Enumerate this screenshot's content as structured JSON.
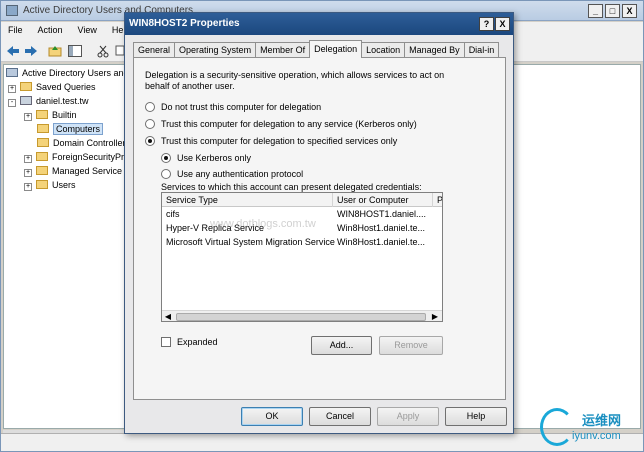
{
  "background_window": {
    "title": "Active Directory Users and Computers",
    "menu": [
      "File",
      "Action",
      "View",
      "Help"
    ],
    "tree": [
      {
        "label": "Active Directory Users and Computers",
        "type": "root"
      },
      {
        "label": "Saved Queries",
        "type": "folder",
        "expander": "+"
      },
      {
        "label": "daniel.test.tw",
        "type": "domain",
        "expander": "-"
      },
      {
        "label": "Builtin",
        "type": "folder",
        "expander": "+"
      },
      {
        "label": "Computers",
        "type": "folder",
        "selected": true
      },
      {
        "label": "Domain Controllers",
        "type": "folder"
      },
      {
        "label": "ForeignSecurityPrincipals",
        "type": "folder",
        "expander": "+"
      },
      {
        "label": "Managed Service Accounts",
        "type": "folder",
        "expander": "+"
      },
      {
        "label": "Users",
        "type": "folder",
        "expander": "+"
      }
    ],
    "window_buttons": [
      "_",
      "□",
      "X"
    ]
  },
  "dialog": {
    "title": "WIN8HOST2 Properties",
    "title_buttons": [
      "?",
      "X"
    ],
    "tabs": [
      {
        "label": "General",
        "active": false
      },
      {
        "label": "Operating System",
        "active": false
      },
      {
        "label": "Member Of",
        "active": false
      },
      {
        "label": "Delegation",
        "active": true
      },
      {
        "label": "Location",
        "active": false
      },
      {
        "label": "Managed By",
        "active": false
      },
      {
        "label": "Dial-in",
        "active": false
      }
    ],
    "description": "Delegation is a security-sensitive operation, which allows services to act on behalf of another user.",
    "options": {
      "opt1": "Do not trust this computer for delegation",
      "opt2": "Trust this computer for delegation to any service (Kerberos only)",
      "opt3": "Trust this computer for delegation to specified services only",
      "sub1": "Use Kerberos only",
      "sub2": "Use any authentication protocol",
      "selected": "opt3",
      "sub_selected": "sub1"
    },
    "services_label": "Services to which this account can present delegated credentials:",
    "services_table": {
      "columns": [
        "Service Type",
        "User or Computer",
        "P"
      ],
      "rows": [
        [
          "cifs",
          "WIN8HOST1.daniel...."
        ],
        [
          "Hyper-V Replica Service",
          "Win8Host1.daniel.te..."
        ],
        [
          "Microsoft Virtual System Migration Service",
          "Win8Host1.daniel.te..."
        ]
      ]
    },
    "expanded_label": "Expanded",
    "expanded_checked": false,
    "add_button": "Add...",
    "remove_button": "Remove",
    "ok_button": "OK",
    "cancel_button": "Cancel",
    "apply_button": "Apply",
    "help_button": "Help"
  },
  "watermark": "www.dotblogs.com.tw",
  "logo": {
    "text1": "运维网",
    "text2": "iyunv.com"
  },
  "colors": {
    "dialog_titlebar": "#1b477e",
    "accent": "#1aa8d8"
  }
}
